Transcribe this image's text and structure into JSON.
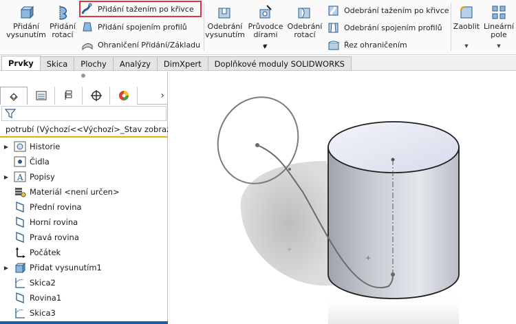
{
  "ribbon": {
    "extrude_boss": "Přidání\nvysunutím",
    "revolve_boss": "Přidání\nrotací",
    "swept_boss": "Přidání tažením po křivce",
    "lofted_boss": "Přidání spojením profilů",
    "boundary_boss": "Ohraničení Přidání/Základu",
    "extrude_cut": "Odebrání\nvysunutím",
    "hole_wizard": "Průvodce\ndírami",
    "revolve_cut": "Odebrání\nrotací",
    "swept_cut": "Odebrání tažením po křivce",
    "lofted_cut": "Odebrání spojením profilů",
    "boundary_cut": "Řez ohraničením",
    "fillet": "Zaoblit",
    "linear_pattern": "Lineární\npole"
  },
  "tabs": [
    "Prvky",
    "Skica",
    "Plochy",
    "Analýzy",
    "DimXpert",
    "Doplňkové moduly SOLIDWORKS"
  ],
  "tree": {
    "root": "potrubí  (Výchozí<<Výchozí>_Stav zobraz",
    "items": [
      {
        "label": "Historie",
        "expandable": true,
        "icon": "history-icon"
      },
      {
        "label": "Čidla",
        "expandable": false,
        "icon": "sensors-icon"
      },
      {
        "label": "Popisy",
        "expandable": true,
        "icon": "annotations-icon"
      },
      {
        "label": "Materiál <není určen>",
        "expandable": false,
        "icon": "material-icon"
      },
      {
        "label": "Přední rovina",
        "expandable": false,
        "icon": "plane-icon"
      },
      {
        "label": "Horní rovina",
        "expandable": false,
        "icon": "plane-icon"
      },
      {
        "label": "Pravá rovina",
        "expandable": false,
        "icon": "plane-icon"
      },
      {
        "label": "Počátek",
        "expandable": false,
        "icon": "origin-icon"
      },
      {
        "label": "Přidat vysunutím1",
        "expandable": true,
        "icon": "extrude-feature-icon"
      },
      {
        "label": "Skica2",
        "expandable": false,
        "icon": "sketch-icon"
      },
      {
        "label": "Rovina1",
        "expandable": false,
        "icon": "plane-icon"
      },
      {
        "label": "Skica3",
        "expandable": false,
        "icon": "sketch-icon"
      }
    ]
  },
  "colors": {
    "highlight": "#d9363e",
    "accent": "#1f5aa8",
    "root_underline": "#e5b200"
  }
}
